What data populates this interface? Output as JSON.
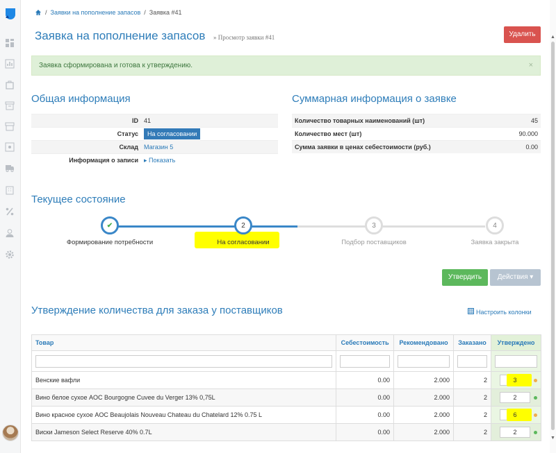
{
  "breadcrumb": {
    "items": [
      "Заявки на пополнение запасов",
      "Заявка #41"
    ]
  },
  "header": {
    "title": "Заявка на пополнение запасов",
    "subtitle": "» Просмотр заявки #41",
    "delete_label": "Удалить"
  },
  "alert": {
    "text": "Заявка сформирована и готова к утверждению.",
    "close": "×"
  },
  "general": {
    "title": "Общая информация",
    "rows": [
      {
        "label": "ID",
        "value": "41"
      },
      {
        "label": "Статус",
        "value": "На согласовании"
      },
      {
        "label": "Склад",
        "value": "Магазин 5"
      },
      {
        "label": "Информация о записи",
        "value": "Показать"
      }
    ]
  },
  "summary": {
    "title": "Суммарная информация о заявке",
    "rows": [
      {
        "label": "Количество товарных наименований (шт)",
        "value": "45"
      },
      {
        "label": "Количество мест (шт)",
        "value": "90.000"
      },
      {
        "label": "Сумма заявки в ценах себестоимости (руб.)",
        "value": "0.00"
      }
    ]
  },
  "state": {
    "title": "Текущее состояние",
    "steps": [
      {
        "num": "✔",
        "label": "Формирование потребности",
        "status": "done"
      },
      {
        "num": "2",
        "label": "На согласовании",
        "status": "active"
      },
      {
        "num": "3",
        "label": "Подбор поставщиков",
        "status": "pending"
      },
      {
        "num": "4",
        "label": "Заявка закрыта",
        "status": "pending"
      }
    ]
  },
  "actions": {
    "approve_label": "Утвердить",
    "actions_label": "Действия ▾"
  },
  "approval": {
    "title": "Утверждение количества для заказа у поставщиков",
    "configure_label": "Настроить колонки",
    "columns": [
      "Товар",
      "Себестоимость",
      "Рекомендовано",
      "Заказано",
      "Утверждено"
    ],
    "rows": [
      {
        "name": "Венские вафли",
        "cost": "0.00",
        "recommended": "2.000",
        "ordered": "2",
        "approved": "3",
        "dot": "orange",
        "highlight": true
      },
      {
        "name": "Вино белое сухое AOC Bourgogne Cuvee du Verger 13% 0,75L",
        "cost": "0.00",
        "recommended": "2.000",
        "ordered": "2",
        "approved": "2",
        "dot": "green",
        "highlight": false
      },
      {
        "name": "Вино красное сухое AOC Beaujolais Nouveau Chateau du Chatelard 12% 0.75 L",
        "cost": "0.00",
        "recommended": "2.000",
        "ordered": "2",
        "approved": "6",
        "dot": "orange",
        "highlight": true
      },
      {
        "name": "Виски Jameson Select Reserve 40% 0.7L",
        "cost": "0.00",
        "recommended": "2.000",
        "ordered": "2",
        "approved": "2",
        "dot": "green",
        "highlight": false
      }
    ]
  },
  "colors": {
    "primary": "#2e7db9",
    "danger": "#d9534f",
    "success": "#5cb85c",
    "highlight": "#ffff00",
    "dot_orange": "#f0ad4e",
    "dot_green": "#5cb85c"
  }
}
